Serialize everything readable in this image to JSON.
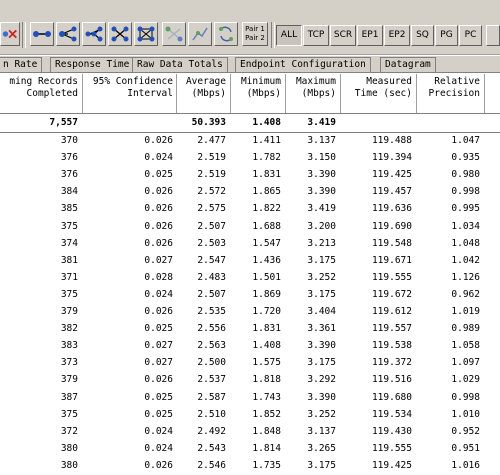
{
  "toolbar": {
    "pair_label_1": "Pair 1",
    "pair_label_2": "Pair 2",
    "protocol_buttons": [
      "ALL",
      "TCP",
      "SCR",
      "EP1",
      "EP2",
      "SQ",
      "PG",
      "PC"
    ]
  },
  "tabs": [
    "n Rate",
    "Response Time",
    "Raw Data Totals",
    "Endpoint Configuration",
    "Datagram"
  ],
  "columns": [
    "ming Records\nCompleted",
    "95% Confidence\nInterval",
    "Average\n(Mbps)",
    "Minimum\n(Mbps)",
    "Maximum\n(Mbps)",
    "Measured\nTime (sec)",
    "Relative\nPrecision"
  ],
  "total_row": {
    "records": "7,557",
    "confidence": "",
    "average": "50.393",
    "minimum": "1.408",
    "maximum": "3.419",
    "time": "",
    "precision": ""
  },
  "rows": [
    [
      "370",
      "0.026",
      "2.477",
      "1.411",
      "3.137",
      "119.488",
      "1.047"
    ],
    [
      "376",
      "0.024",
      "2.519",
      "1.782",
      "3.150",
      "119.394",
      "0.935"
    ],
    [
      "376",
      "0.025",
      "2.519",
      "1.831",
      "3.390",
      "119.425",
      "0.980"
    ],
    [
      "384",
      "0.026",
      "2.572",
      "1.865",
      "3.390",
      "119.457",
      "0.998"
    ],
    [
      "385",
      "0.026",
      "2.575",
      "1.822",
      "3.419",
      "119.636",
      "0.995"
    ],
    [
      "375",
      "0.026",
      "2.507",
      "1.688",
      "3.200",
      "119.690",
      "1.034"
    ],
    [
      "374",
      "0.026",
      "2.503",
      "1.547",
      "3.213",
      "119.548",
      "1.048"
    ],
    [
      "381",
      "0.027",
      "2.547",
      "1.436",
      "3.175",
      "119.671",
      "1.042"
    ],
    [
      "371",
      "0.028",
      "2.483",
      "1.501",
      "3.252",
      "119.555",
      "1.126"
    ],
    [
      "375",
      "0.024",
      "2.507",
      "1.869",
      "3.175",
      "119.672",
      "0.962"
    ],
    [
      "379",
      "0.026",
      "2.535",
      "1.720",
      "3.404",
      "119.612",
      "1.019"
    ],
    [
      "382",
      "0.025",
      "2.556",
      "1.831",
      "3.361",
      "119.557",
      "0.989"
    ],
    [
      "383",
      "0.027",
      "2.563",
      "1.408",
      "3.390",
      "119.538",
      "1.058"
    ],
    [
      "373",
      "0.027",
      "2.500",
      "1.575",
      "3.175",
      "119.372",
      "1.097"
    ],
    [
      "379",
      "0.026",
      "2.537",
      "1.818",
      "3.292",
      "119.516",
      "1.029"
    ],
    [
      "387",
      "0.025",
      "2.587",
      "1.743",
      "3.390",
      "119.680",
      "0.998"
    ],
    [
      "375",
      "0.025",
      "2.510",
      "1.852",
      "3.252",
      "119.534",
      "1.010"
    ],
    [
      "372",
      "0.024",
      "2.492",
      "1.848",
      "3.137",
      "119.430",
      "0.952"
    ],
    [
      "380",
      "0.024",
      "2.543",
      "1.814",
      "3.265",
      "119.555",
      "0.951"
    ],
    [
      "380",
      "0.026",
      "2.546",
      "1.735",
      "3.175",
      "119.425",
      "1.016"
    ]
  ]
}
